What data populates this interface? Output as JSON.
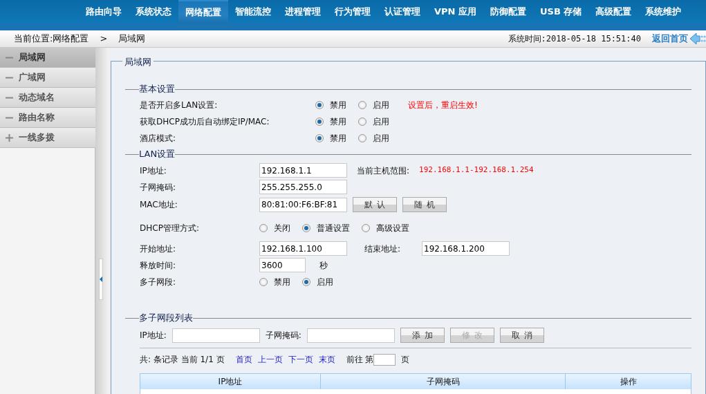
{
  "nav": {
    "items": [
      {
        "label": "路由向导",
        "selected": false
      },
      {
        "label": "系统状态",
        "selected": false
      },
      {
        "label": "网络配置",
        "selected": true
      },
      {
        "label": "智能流控",
        "selected": false
      },
      {
        "label": "进程管理",
        "selected": false
      },
      {
        "label": "行为管理",
        "selected": false
      },
      {
        "label": "认证管理",
        "selected": false
      },
      {
        "label": "VPN 应用",
        "selected": false
      },
      {
        "label": "防御配置",
        "selected": false
      },
      {
        "label": "USB 存储",
        "selected": false
      },
      {
        "label": "高级配置",
        "selected": false
      },
      {
        "label": "系统维护",
        "selected": false
      }
    ]
  },
  "breadcrumb": {
    "location": "当前位置:网络配置",
    "separator": ">",
    "current": "局域网",
    "system_time": "系统时间:2018-05-18 15:51:40",
    "home_link": "返回首页"
  },
  "sidebar": {
    "items": [
      {
        "label": "局域网",
        "expanded": true,
        "selected": true
      },
      {
        "label": "广域网",
        "expanded": true,
        "selected": false
      },
      {
        "label": "动态域名",
        "expanded": true,
        "selected": false
      },
      {
        "label": "路由名称",
        "expanded": true,
        "selected": false
      },
      {
        "label": "一线多拨",
        "expanded": false,
        "selected": false
      }
    ]
  },
  "panel": {
    "title": "局域网",
    "basic_settings": {
      "title": "基本设置",
      "rows": [
        {
          "label": "是否开启多LAN设置:",
          "options": [
            {
              "label": "禁用",
              "selected": true
            },
            {
              "label": "启用",
              "selected": false
            }
          ],
          "note": "设置后，重启生效!"
        },
        {
          "label": "获取DHCP成功后自动绑定IP/MAC:",
          "options": [
            {
              "label": "禁用",
              "selected": true
            },
            {
              "label": "启用",
              "selected": false
            }
          ]
        },
        {
          "label": "酒店模式:",
          "options": [
            {
              "label": "禁用",
              "selected": true
            },
            {
              "label": "启用",
              "selected": false
            }
          ]
        }
      ]
    },
    "lan_settings": {
      "title": "LAN设置",
      "rows": [
        {
          "kind": "text",
          "label": "IP地址:",
          "value": "192.168.1.1",
          "info_label": "当前主机范围:",
          "info_value": "192.168.1.1-192.168.1.254"
        },
        {
          "kind": "text",
          "label": "子网掩码:",
          "value": "255.255.255.0"
        },
        {
          "kind": "buttons",
          "label": "MAC地址:",
          "value": "80:81:00:F6:BF:81",
          "buttons": [
            {
              "label": "默认",
              "disabled": false
            },
            {
              "label": "随机",
              "disabled": false
            }
          ]
        },
        {
          "kind": "radio",
          "label": "DHCP管理方式:",
          "options": [
            {
              "label": "关闭",
              "selected": false
            },
            {
              "label": "普通设置",
              "selected": true
            },
            {
              "label": "高级设置",
              "selected": false
            }
          ]
        },
        {
          "kind": "range",
          "label": "开始地址:",
          "value": "192.168.1.100",
          "end_label": "结束地址:",
          "end_value": "192.168.1.200"
        },
        {
          "kind": "unit",
          "label": "释放时间:",
          "value": "3600",
          "unit": "秒"
        },
        {
          "kind": "radio",
          "label": "多子网段:",
          "options": [
            {
              "label": "禁用",
              "selected": false
            },
            {
              "label": "启用",
              "selected": true
            }
          ]
        }
      ]
    },
    "subnet_list": {
      "title": "多子网段列表",
      "ip_label": "IP地址:",
      "mask_label": "子网掩码:",
      "buttons": [
        {
          "label": "添加",
          "disabled": false
        },
        {
          "label": "修改",
          "disabled": true
        },
        {
          "label": "取消",
          "disabled": false
        }
      ],
      "pagination": {
        "summary": "共: 条记录 当前 1/1 页",
        "links": [
          "首页",
          "上一页",
          "下一页",
          "末页"
        ],
        "goto_label": "前往 第",
        "page_suffix": "页"
      },
      "table": {
        "columns": [
          "IP地址",
          "子网掩码",
          "操作"
        ]
      }
    }
  }
}
